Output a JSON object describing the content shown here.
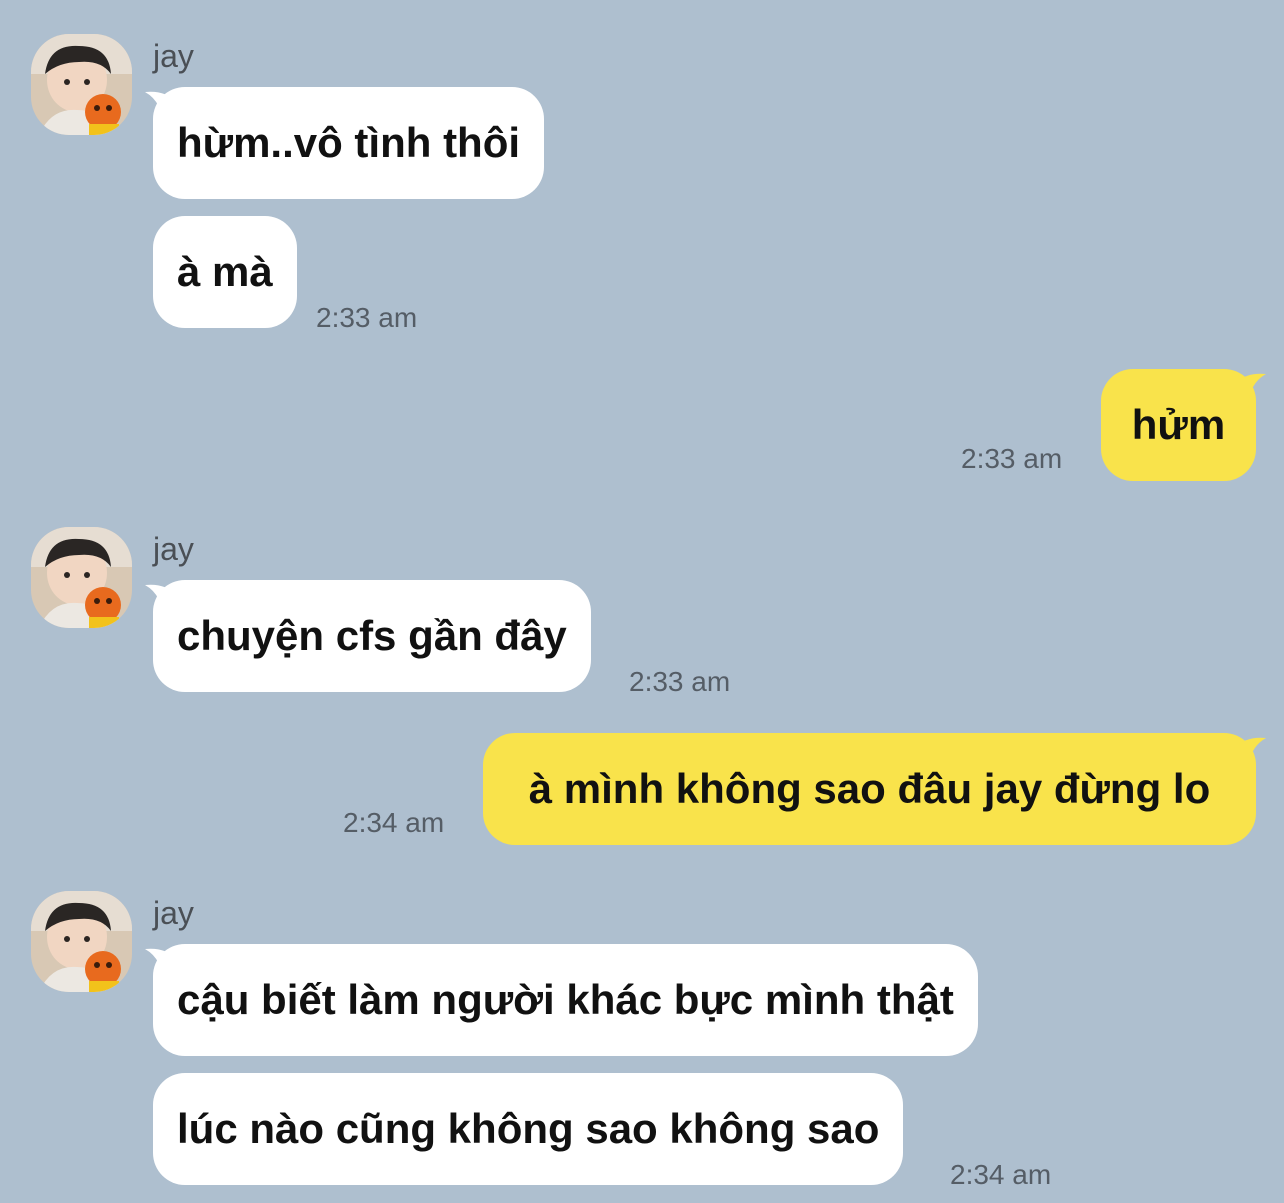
{
  "contact": {
    "name": "jay",
    "avatar": "avatar-child-with-orange-toy"
  },
  "messages": [
    {
      "direction": "in",
      "sender": "jay",
      "text": "hừm..vô tình thôi"
    },
    {
      "direction": "in",
      "text": "à mà",
      "time": "2:33 am"
    },
    {
      "direction": "out",
      "text": "hửm",
      "time": "2:33 am"
    },
    {
      "direction": "in",
      "sender": "jay",
      "text": "chuyện cfs gần đây",
      "time": "2:33 am"
    },
    {
      "direction": "out",
      "text": "à mình không sao đâu jay đừng lo",
      "time": "2:34 am"
    },
    {
      "direction": "in",
      "sender": "jay",
      "text": "cậu biết làm người khác bực mình thật"
    },
    {
      "direction": "in",
      "text": "lúc nào cũng không sao không sao",
      "time": "2:34 am"
    }
  ],
  "colors": {
    "background": "#aebfcf",
    "incoming_bubble": "#ffffff",
    "outgoing_bubble": "#f9e34b"
  }
}
